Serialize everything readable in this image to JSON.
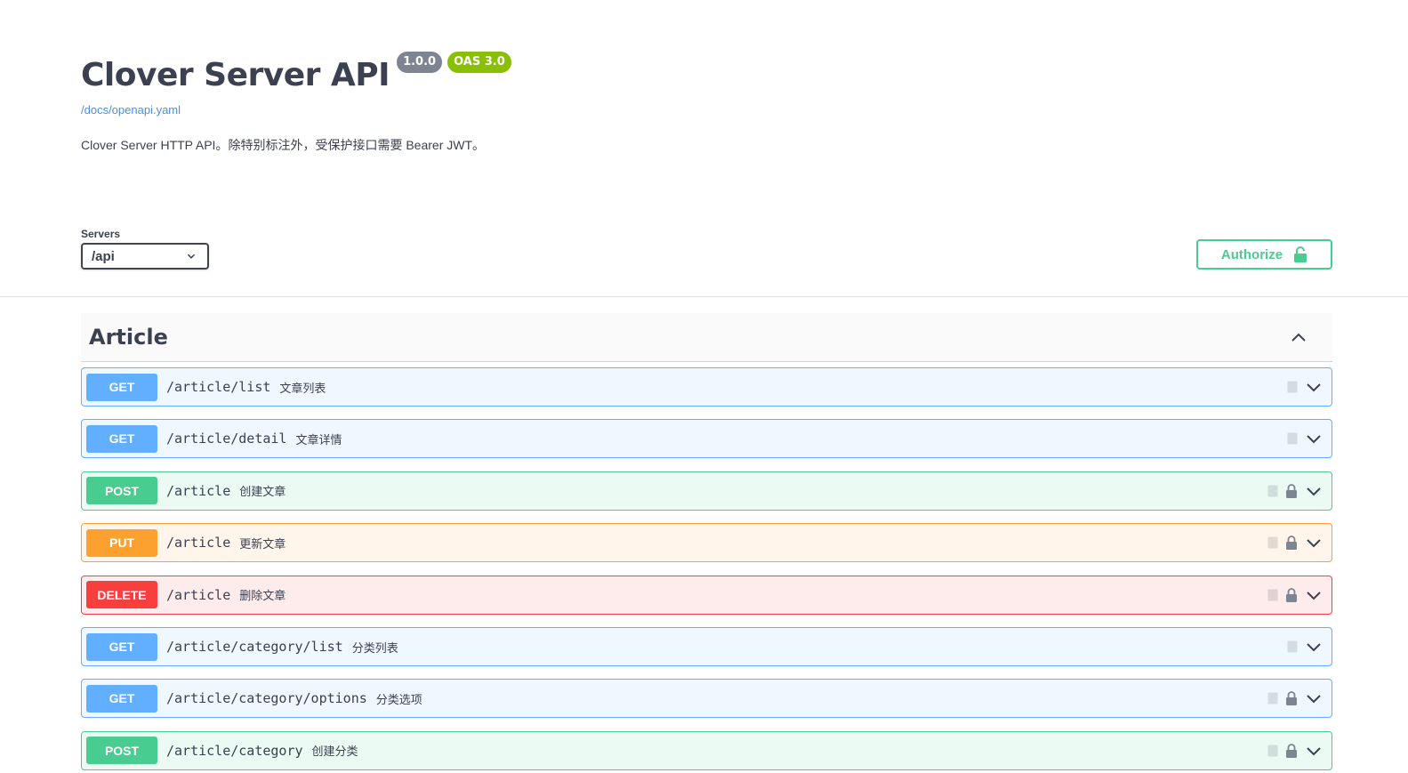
{
  "info": {
    "title": "Clover Server API",
    "version": "1.0.0",
    "oas": "OAS 3.0",
    "spec_url": "/docs/openapi.yaml",
    "description": "Clover Server HTTP API。除特别标注外，受保护接口需要 Bearer JWT。"
  },
  "servers": {
    "label": "Servers",
    "selected": "/api"
  },
  "authorize": {
    "label": "Authorize"
  },
  "section": {
    "title": "Article",
    "operations": [
      {
        "method": "GET",
        "path": "/article/list",
        "summary": "文章列表",
        "locked": false
      },
      {
        "method": "GET",
        "path": "/article/detail",
        "summary": "文章详情",
        "locked": false
      },
      {
        "method": "POST",
        "path": "/article",
        "summary": "创建文章",
        "locked": true
      },
      {
        "method": "PUT",
        "path": "/article",
        "summary": "更新文章",
        "locked": true
      },
      {
        "method": "DELETE",
        "path": "/article",
        "summary": "删除文章",
        "locked": true
      },
      {
        "method": "GET",
        "path": "/article/category/list",
        "summary": "分类列表",
        "locked": false
      },
      {
        "method": "GET",
        "path": "/article/category/options",
        "summary": "分类选项",
        "locked": true
      },
      {
        "method": "POST",
        "path": "/article/category",
        "summary": "创建分类",
        "locked": true
      }
    ]
  },
  "colors": {
    "get": "#61affe",
    "post": "#49cc90",
    "put": "#fca130",
    "delete": "#f93e3e",
    "version_badge": "#7d8492",
    "oas_badge": "#89bf04"
  }
}
